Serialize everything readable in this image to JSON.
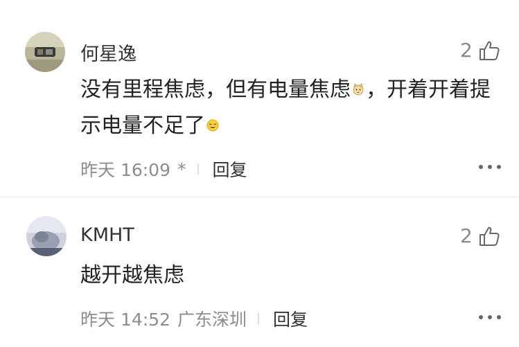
{
  "comments": [
    {
      "username": "何星逸",
      "likes": "2",
      "text_parts": [
        "没有里程焦虑，但有电量焦虑",
        "，开着开着提示电量不足了"
      ],
      "emojis": [
        "cat-emoji",
        "laughing-emoji"
      ],
      "time": "昨天 16:09",
      "location": "*",
      "reply_label": "回复"
    },
    {
      "username": "KMHT",
      "likes": "2",
      "text": "越开越焦虑",
      "time": "昨天 14:52",
      "location": "广东深圳",
      "reply_label": "回复"
    }
  ]
}
